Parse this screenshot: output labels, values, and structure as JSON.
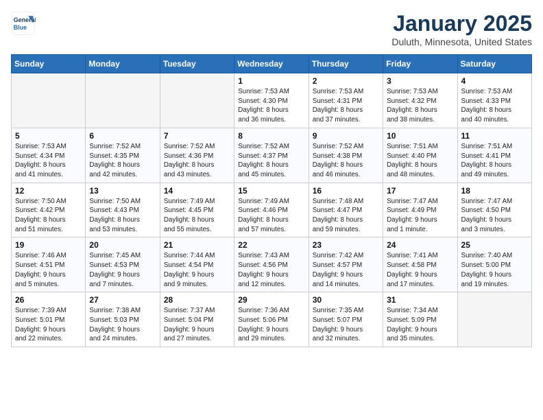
{
  "header": {
    "logo_line1": "General",
    "logo_line2": "Blue",
    "month": "January 2025",
    "location": "Duluth, Minnesota, United States"
  },
  "weekdays": [
    "Sunday",
    "Monday",
    "Tuesday",
    "Wednesday",
    "Thursday",
    "Friday",
    "Saturday"
  ],
  "weeks": [
    [
      {
        "day": "",
        "info": ""
      },
      {
        "day": "",
        "info": ""
      },
      {
        "day": "",
        "info": ""
      },
      {
        "day": "1",
        "info": "Sunrise: 7:53 AM\nSunset: 4:30 PM\nDaylight: 8 hours\nand 36 minutes."
      },
      {
        "day": "2",
        "info": "Sunrise: 7:53 AM\nSunset: 4:31 PM\nDaylight: 8 hours\nand 37 minutes."
      },
      {
        "day": "3",
        "info": "Sunrise: 7:53 AM\nSunset: 4:32 PM\nDaylight: 8 hours\nand 38 minutes."
      },
      {
        "day": "4",
        "info": "Sunrise: 7:53 AM\nSunset: 4:33 PM\nDaylight: 8 hours\nand 40 minutes."
      }
    ],
    [
      {
        "day": "5",
        "info": "Sunrise: 7:53 AM\nSunset: 4:34 PM\nDaylight: 8 hours\nand 41 minutes."
      },
      {
        "day": "6",
        "info": "Sunrise: 7:52 AM\nSunset: 4:35 PM\nDaylight: 8 hours\nand 42 minutes."
      },
      {
        "day": "7",
        "info": "Sunrise: 7:52 AM\nSunset: 4:36 PM\nDaylight: 8 hours\nand 43 minutes."
      },
      {
        "day": "8",
        "info": "Sunrise: 7:52 AM\nSunset: 4:37 PM\nDaylight: 8 hours\nand 45 minutes."
      },
      {
        "day": "9",
        "info": "Sunrise: 7:52 AM\nSunset: 4:38 PM\nDaylight: 8 hours\nand 46 minutes."
      },
      {
        "day": "10",
        "info": "Sunrise: 7:51 AM\nSunset: 4:40 PM\nDaylight: 8 hours\nand 48 minutes."
      },
      {
        "day": "11",
        "info": "Sunrise: 7:51 AM\nSunset: 4:41 PM\nDaylight: 8 hours\nand 49 minutes."
      }
    ],
    [
      {
        "day": "12",
        "info": "Sunrise: 7:50 AM\nSunset: 4:42 PM\nDaylight: 8 hours\nand 51 minutes."
      },
      {
        "day": "13",
        "info": "Sunrise: 7:50 AM\nSunset: 4:43 PM\nDaylight: 8 hours\nand 53 minutes."
      },
      {
        "day": "14",
        "info": "Sunrise: 7:49 AM\nSunset: 4:45 PM\nDaylight: 8 hours\nand 55 minutes."
      },
      {
        "day": "15",
        "info": "Sunrise: 7:49 AM\nSunset: 4:46 PM\nDaylight: 8 hours\nand 57 minutes."
      },
      {
        "day": "16",
        "info": "Sunrise: 7:48 AM\nSunset: 4:47 PM\nDaylight: 8 hours\nand 59 minutes."
      },
      {
        "day": "17",
        "info": "Sunrise: 7:47 AM\nSunset: 4:49 PM\nDaylight: 9 hours\nand 1 minute."
      },
      {
        "day": "18",
        "info": "Sunrise: 7:47 AM\nSunset: 4:50 PM\nDaylight: 9 hours\nand 3 minutes."
      }
    ],
    [
      {
        "day": "19",
        "info": "Sunrise: 7:46 AM\nSunset: 4:51 PM\nDaylight: 9 hours\nand 5 minutes."
      },
      {
        "day": "20",
        "info": "Sunrise: 7:45 AM\nSunset: 4:53 PM\nDaylight: 9 hours\nand 7 minutes."
      },
      {
        "day": "21",
        "info": "Sunrise: 7:44 AM\nSunset: 4:54 PM\nDaylight: 9 hours\nand 9 minutes."
      },
      {
        "day": "22",
        "info": "Sunrise: 7:43 AM\nSunset: 4:56 PM\nDaylight: 9 hours\nand 12 minutes."
      },
      {
        "day": "23",
        "info": "Sunrise: 7:42 AM\nSunset: 4:57 PM\nDaylight: 9 hours\nand 14 minutes."
      },
      {
        "day": "24",
        "info": "Sunrise: 7:41 AM\nSunset: 4:58 PM\nDaylight: 9 hours\nand 17 minutes."
      },
      {
        "day": "25",
        "info": "Sunrise: 7:40 AM\nSunset: 5:00 PM\nDaylight: 9 hours\nand 19 minutes."
      }
    ],
    [
      {
        "day": "26",
        "info": "Sunrise: 7:39 AM\nSunset: 5:01 PM\nDaylight: 9 hours\nand 22 minutes."
      },
      {
        "day": "27",
        "info": "Sunrise: 7:38 AM\nSunset: 5:03 PM\nDaylight: 9 hours\nand 24 minutes."
      },
      {
        "day": "28",
        "info": "Sunrise: 7:37 AM\nSunset: 5:04 PM\nDaylight: 9 hours\nand 27 minutes."
      },
      {
        "day": "29",
        "info": "Sunrise: 7:36 AM\nSunset: 5:06 PM\nDaylight: 9 hours\nand 29 minutes."
      },
      {
        "day": "30",
        "info": "Sunrise: 7:35 AM\nSunset: 5:07 PM\nDaylight: 9 hours\nand 32 minutes."
      },
      {
        "day": "31",
        "info": "Sunrise: 7:34 AM\nSunset: 5:09 PM\nDaylight: 9 hours\nand 35 minutes."
      },
      {
        "day": "",
        "info": ""
      }
    ]
  ]
}
